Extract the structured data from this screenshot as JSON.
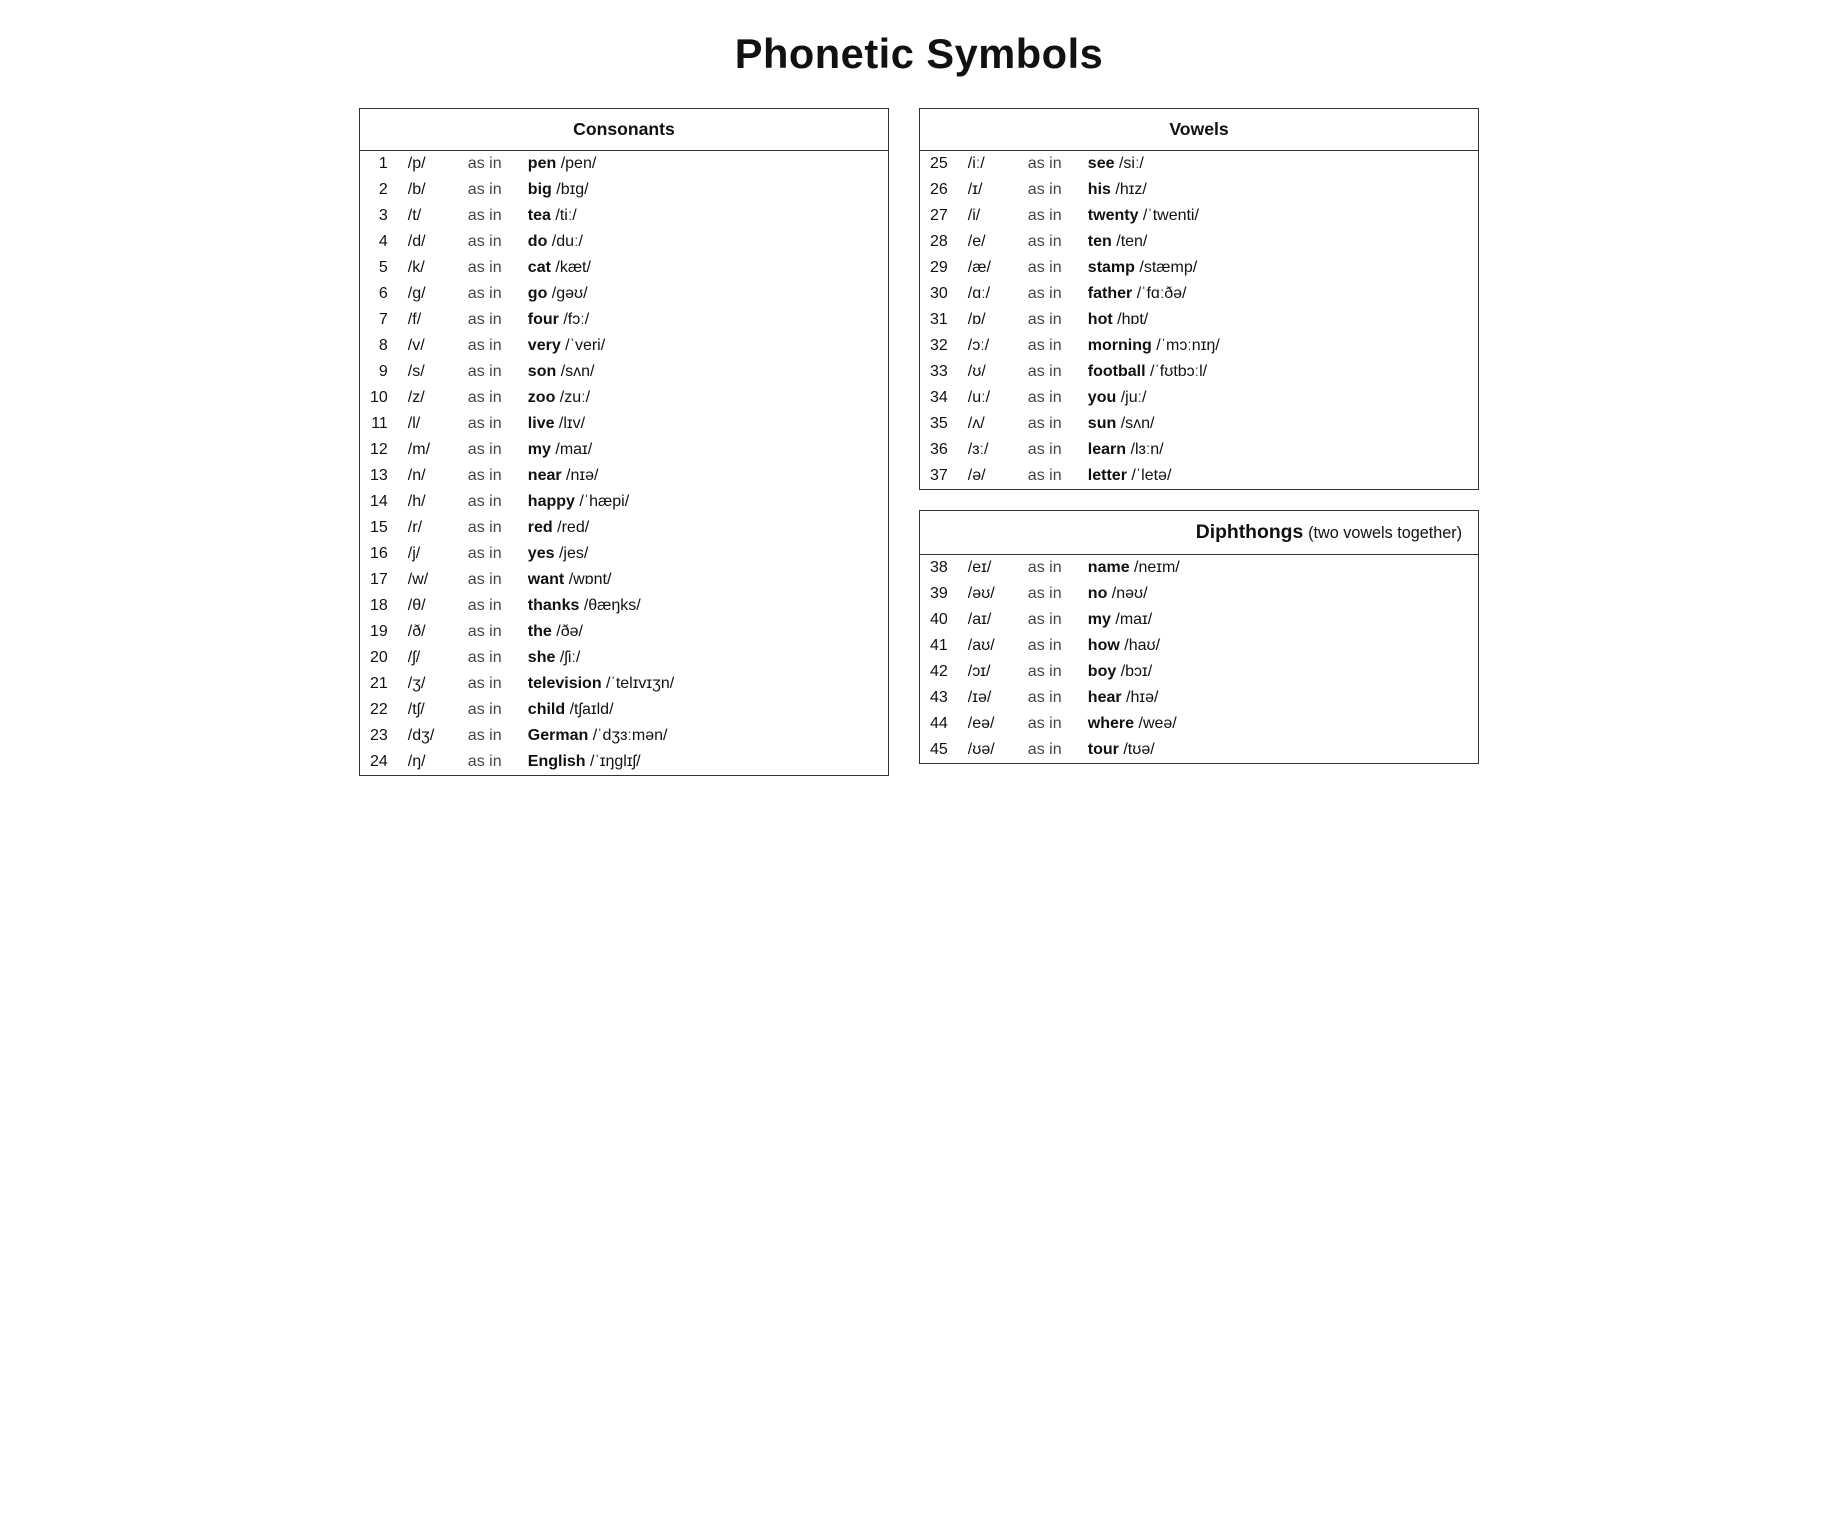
{
  "title": "Phonetic Symbols",
  "consonants": {
    "header": "Consonants",
    "rows": [
      {
        "num": "1",
        "symbol": "/p/",
        "asin": "as in",
        "word": "pen",
        "ipa": "/pen/"
      },
      {
        "num": "2",
        "symbol": "/b/",
        "asin": "as in",
        "word": "big",
        "ipa": "/bɪg/"
      },
      {
        "num": "3",
        "symbol": "/t/",
        "asin": "as in",
        "word": "tea",
        "ipa": "/tiː/"
      },
      {
        "num": "4",
        "symbol": "/d/",
        "asin": "as in",
        "word": "do",
        "ipa": "/duː/"
      },
      {
        "num": "5",
        "symbol": "/k/",
        "asin": "as in",
        "word": "cat",
        "ipa": "/kæt/"
      },
      {
        "num": "6",
        "symbol": "/g/",
        "asin": "as in",
        "word": "go",
        "ipa": "/gəʊ/"
      },
      {
        "num": "7",
        "symbol": "/f/",
        "asin": "as in",
        "word": "four",
        "ipa": "/fɔː/"
      },
      {
        "num": "8",
        "symbol": "/v/",
        "asin": "as in",
        "word": "very",
        "ipa": "/ˈveri/"
      },
      {
        "num": "9",
        "symbol": "/s/",
        "asin": "as in",
        "word": "son",
        "ipa": "/sʌn/"
      },
      {
        "num": "10",
        "symbol": "/z/",
        "asin": "as in",
        "word": "zoo",
        "ipa": "/zuː/"
      },
      {
        "num": "11",
        "symbol": "/l/",
        "asin": "as in",
        "word": "live",
        "ipa": "/lɪv/"
      },
      {
        "num": "12",
        "symbol": "/m/",
        "asin": "as in",
        "word": "my",
        "ipa": "/maɪ/"
      },
      {
        "num": "13",
        "symbol": "/n/",
        "asin": "as in",
        "word": "near",
        "ipa": "/nɪə/"
      },
      {
        "num": "14",
        "symbol": "/h/",
        "asin": "as in",
        "word": "happy",
        "ipa": "/ˈhæpi/"
      },
      {
        "num": "15",
        "symbol": "/r/",
        "asin": "as in",
        "word": "red",
        "ipa": "/red/"
      },
      {
        "num": "16",
        "symbol": "/j/",
        "asin": "as in",
        "word": "yes",
        "ipa": "/jes/"
      },
      {
        "num": "17",
        "symbol": "/w/",
        "asin": "as in",
        "word": "want",
        "ipa": "/wɒnt/"
      },
      {
        "num": "18",
        "symbol": "/θ/",
        "asin": "as in",
        "word": "thanks",
        "ipa": "/θæŋks/"
      },
      {
        "num": "19",
        "symbol": "/ð/",
        "asin": "as in",
        "word": "the",
        "ipa": "/ðə/"
      },
      {
        "num": "20",
        "symbol": "/ʃ/",
        "asin": "as in",
        "word": "she",
        "ipa": "/ʃiː/"
      },
      {
        "num": "21",
        "symbol": "/ʒ/",
        "asin": "as in",
        "word": "television",
        "ipa": "/ˈtelɪvɪʒn/"
      },
      {
        "num": "22",
        "symbol": "/tʃ/",
        "asin": "as in",
        "word": "child",
        "ipa": "/tʃaɪld/"
      },
      {
        "num": "23",
        "symbol": "/dʒ/",
        "asin": "as in",
        "word": "German",
        "ipa": "/ˈdʒɜːmən/"
      },
      {
        "num": "24",
        "symbol": "/ŋ/",
        "asin": "as in",
        "word": "English",
        "ipa": "/ˈɪŋglɪʃ/"
      }
    ]
  },
  "vowels": {
    "header": "Vowels",
    "rows": [
      {
        "num": "25",
        "symbol": "/iː/",
        "asin": "as in",
        "word": "see",
        "ipa": "/siː/"
      },
      {
        "num": "26",
        "symbol": "/ɪ/",
        "asin": "as in",
        "word": "his",
        "ipa": "/hɪz/"
      },
      {
        "num": "27",
        "symbol": "/i/",
        "asin": "as in",
        "word": "twenty",
        "ipa": "/ˈtwenti/"
      },
      {
        "num": "28",
        "symbol": "/e/",
        "asin": "as in",
        "word": "ten",
        "ipa": "/ten/"
      },
      {
        "num": "29",
        "symbol": "/æ/",
        "asin": "as in",
        "word": "stamp",
        "ipa": "/stæmp/"
      },
      {
        "num": "30",
        "symbol": "/ɑː/",
        "asin": "as in",
        "word": "father",
        "ipa": "/ˈfɑːðə/"
      },
      {
        "num": "31",
        "symbol": "/ɒ/",
        "asin": "as in",
        "word": "hot",
        "ipa": "/hɒt/"
      },
      {
        "num": "32",
        "symbol": "/ɔː/",
        "asin": "as in",
        "word": "morning",
        "ipa": "/ˈmɔːnɪŋ/"
      },
      {
        "num": "33",
        "symbol": "/ʊ/",
        "asin": "as in",
        "word": "football",
        "ipa": "/ˈfʊtbɔːl/"
      },
      {
        "num": "34",
        "symbol": "/uː/",
        "asin": "as in",
        "word": "you",
        "ipa": "/juː/"
      },
      {
        "num": "35",
        "symbol": "/ʌ/",
        "asin": "as in",
        "word": "sun",
        "ipa": "/sʌn/"
      },
      {
        "num": "36",
        "symbol": "/ɜː/",
        "asin": "as in",
        "word": "learn",
        "ipa": "/lɜːn/"
      },
      {
        "num": "37",
        "symbol": "/ə/",
        "asin": "as in",
        "word": "letter",
        "ipa": "/ˈletə/"
      }
    ]
  },
  "diphthongs": {
    "header": "Diphthongs",
    "subtitle": "(two vowels together)",
    "rows": [
      {
        "num": "38",
        "symbol": "/eɪ/",
        "asin": "as in",
        "word": "name",
        "ipa": "/neɪm/"
      },
      {
        "num": "39",
        "symbol": "/əʊ/",
        "asin": "as in",
        "word": "no",
        "ipa": "/nəʊ/"
      },
      {
        "num": "40",
        "symbol": "/aɪ/",
        "asin": "as in",
        "word": "my",
        "ipa": "/maɪ/"
      },
      {
        "num": "41",
        "symbol": "/aʊ/",
        "asin": "as in",
        "word": "how",
        "ipa": "/haʊ/"
      },
      {
        "num": "42",
        "symbol": "/ɔɪ/",
        "asin": "as in",
        "word": "boy",
        "ipa": "/bɔɪ/"
      },
      {
        "num": "43",
        "symbol": "/ɪə/",
        "asin": "as in",
        "word": "hear",
        "ipa": "/hɪə/"
      },
      {
        "num": "44",
        "symbol": "/eə/",
        "asin": "as in",
        "word": "where",
        "ipa": "/weə/"
      },
      {
        "num": "45",
        "symbol": "/ʊə/",
        "asin": "as in",
        "word": "tour",
        "ipa": "/tʊə/"
      }
    ]
  }
}
